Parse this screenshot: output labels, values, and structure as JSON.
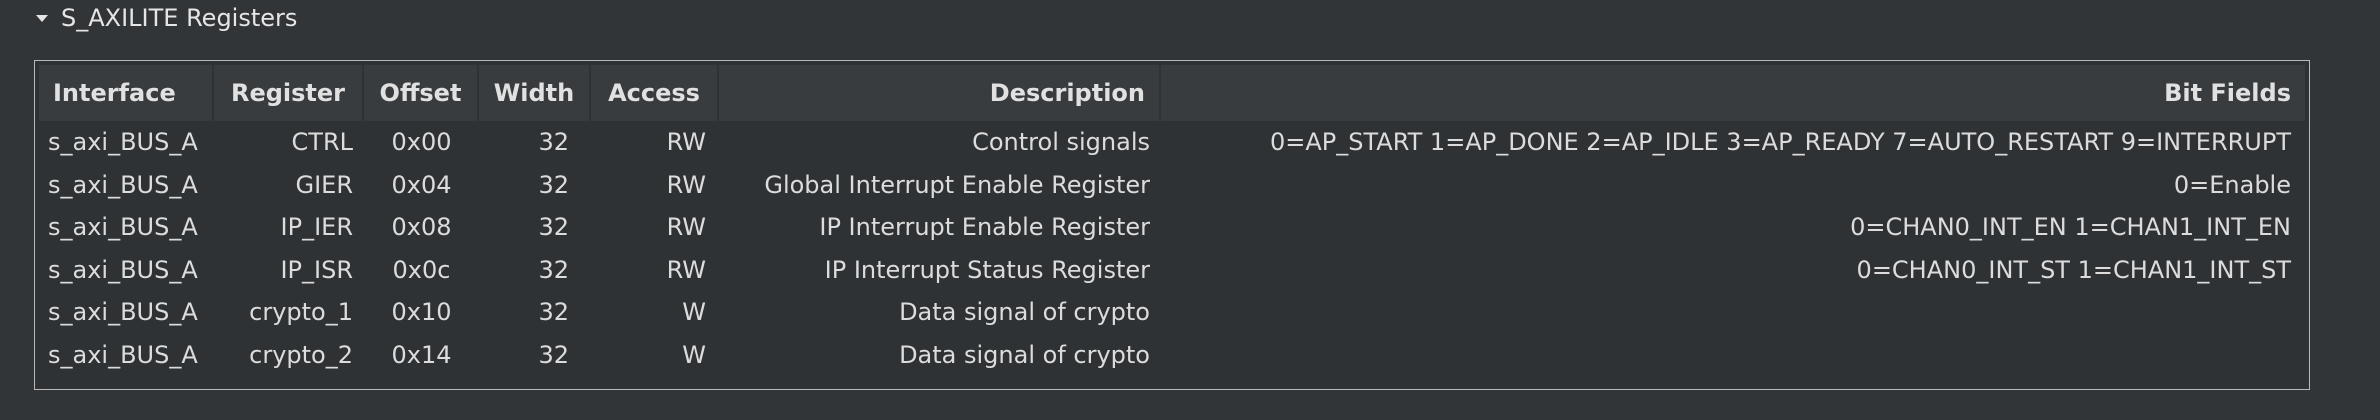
{
  "section": {
    "title": "S_AXILITE Registers",
    "caret_icon": "caret-down-icon"
  },
  "table": {
    "columns": [
      "Interface",
      "Register",
      "Offset",
      "Width",
      "Access",
      "Description",
      "Bit Fields"
    ],
    "rows": [
      [
        "s_axi_BUS_A",
        "CTRL",
        "0x00",
        "32",
        "RW",
        "Control signals",
        "0=AP_START 1=AP_DONE 2=AP_IDLE 3=AP_READY 7=AUTO_RESTART 9=INTERRUPT"
      ],
      [
        "s_axi_BUS_A",
        "GIER",
        "0x04",
        "32",
        "RW",
        "Global Interrupt Enable Register",
        "0=Enable"
      ],
      [
        "s_axi_BUS_A",
        "IP_IER",
        "0x08",
        "32",
        "RW",
        "IP Interrupt Enable Register",
        "0=CHAN0_INT_EN 1=CHAN1_INT_EN"
      ],
      [
        "s_axi_BUS_A",
        "IP_ISR",
        "0x0c",
        "32",
        "RW",
        "IP Interrupt Status Register",
        "0=CHAN0_INT_ST 1=CHAN1_INT_ST"
      ],
      [
        "s_axi_BUS_A",
        "crypto_1",
        "0x10",
        "32",
        "W",
        "Data signal of crypto",
        ""
      ],
      [
        "s_axi_BUS_A",
        "crypto_2",
        "0x14",
        "32",
        "W",
        "Data signal of crypto",
        ""
      ]
    ]
  },
  "colors": {
    "background": "#323538",
    "header_row": "#393c3e",
    "border": "#b9b9b9",
    "text": "#dcdcdc"
  }
}
